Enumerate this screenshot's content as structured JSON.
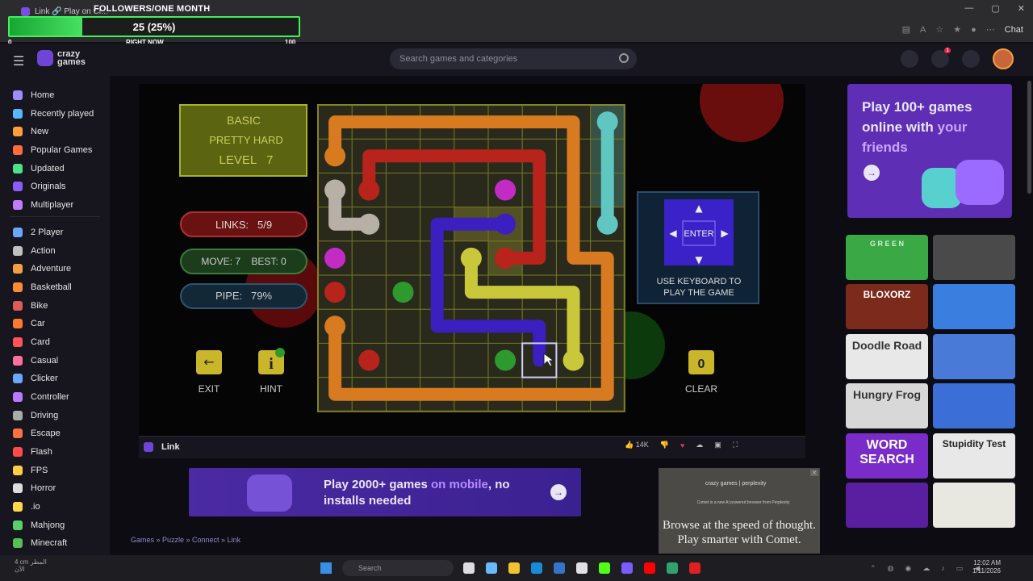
{
  "browser": {
    "tab_title": "Link 🔗 Play on Cr...",
    "chat_label": "Chat",
    "win_min": "—",
    "win_max": "▢",
    "win_close": "✕"
  },
  "overlay": {
    "title": "FOLLOWERS/ONE MONTH",
    "value": "25 (25%)",
    "progress": 0.25,
    "min": "0",
    "now_label": "RIGHT NOW",
    "max": "100"
  },
  "header": {
    "logo_text": "crazy games",
    "search_placeholder": "Search games and categories",
    "notification_count": "1"
  },
  "sidebar": {
    "items": [
      {
        "label": "Home",
        "color": "#9b8cff"
      },
      {
        "label": "Recently played",
        "color": "#58b6ff"
      },
      {
        "label": "New",
        "color": "#ff9d3b"
      },
      {
        "label": "Popular Games",
        "color": "#ff6b3b"
      },
      {
        "label": "Updated",
        "color": "#4be38a"
      },
      {
        "label": "Originals",
        "color": "#8b5cff"
      },
      {
        "label": "Multiplayer",
        "color": "#c07bff"
      },
      {
        "label": "2 Player",
        "color": "#6aa8ff"
      },
      {
        "label": "Action",
        "color": "#c0c0c0"
      },
      {
        "label": "Adventure",
        "color": "#f0a040"
      },
      {
        "label": "Basketball",
        "color": "#ff8a33"
      },
      {
        "label": "Bike",
        "color": "#e05a5a"
      },
      {
        "label": "Car",
        "color": "#ff7a30"
      },
      {
        "label": "Card",
        "color": "#ff5454"
      },
      {
        "label": "Casual",
        "color": "#ff6f9c"
      },
      {
        "label": "Clicker",
        "color": "#6aa8ff"
      },
      {
        "label": "Controller",
        "color": "#b87bff"
      },
      {
        "label": "Driving",
        "color": "#aaaaaa"
      },
      {
        "label": "Escape",
        "color": "#ff7040"
      },
      {
        "label": "Flash",
        "color": "#ff4a4a"
      },
      {
        "label": "FPS",
        "color": "#ffcc44"
      },
      {
        "label": "Horror",
        "color": "#dddddd"
      },
      {
        "label": ".io",
        "color": "#ffd84a"
      },
      {
        "label": "Mahjong",
        "color": "#5ad06a"
      },
      {
        "label": "Minecraft",
        "color": "#55c050"
      }
    ]
  },
  "game": {
    "mode": "BASIC",
    "difficulty": "PRETTY HARD",
    "level": "LEVEL   7",
    "links": "LINKS:   5/9",
    "move_best": "MOVE: 7    BEST: 0",
    "pipe": "PIPE:   79%",
    "exit_label": "EXIT",
    "hint_label": "HINT",
    "clear_count": "0",
    "clear_label": "CLEAR",
    "enter_label": "ENTER",
    "keyboard_hint": "USE KEYBOARD TO PLAY THE GAME",
    "colors": {
      "orange": "#d87a1f",
      "red": "#b8241c",
      "white": "#b6b0a6",
      "magenta": "#c22cc4",
      "cyan": "#5fc6c0",
      "blue": "#3b1fbf",
      "yellow": "#c8c83a",
      "green": "#2e9a2e"
    }
  },
  "game_bar": {
    "title": "Link",
    "likes": "14K"
  },
  "promo": {
    "text_a": "Play 2000+ games ",
    "text_hl": "on mobile",
    "text_b": ", no installs needed"
  },
  "breadcrumb": "Games » Puzzle » Connect » Link",
  "ad": {
    "brand": "crazy games | perplexity",
    "small": "Comet is a new AI powered browser from Perplexity",
    "big": "Browse at the speed of thought. Play smarter with Comet."
  },
  "right_promo": {
    "text_a": "Play 100+ games online with ",
    "text_hl": "your friends"
  },
  "thumbs": [
    {
      "label": "G R E E N"
    },
    {
      "label": ""
    },
    {
      "label": "BLOXORZ"
    },
    {
      "label": ""
    },
    {
      "label": "Doodle Road"
    },
    {
      "label": ""
    },
    {
      "label": "Hungry Frog"
    },
    {
      "label": ""
    },
    {
      "label": "WORD SEARCH"
    },
    {
      "label": "Stupidity Test"
    },
    {
      "label": ""
    },
    {
      "label": ""
    }
  ],
  "taskbar": {
    "weather_temp": "4 cm",
    "weather_text": "المطر",
    "weather_sub": "الآن",
    "search_label": "Search",
    "time": "12:02 AM",
    "date": "1/11/2026"
  }
}
